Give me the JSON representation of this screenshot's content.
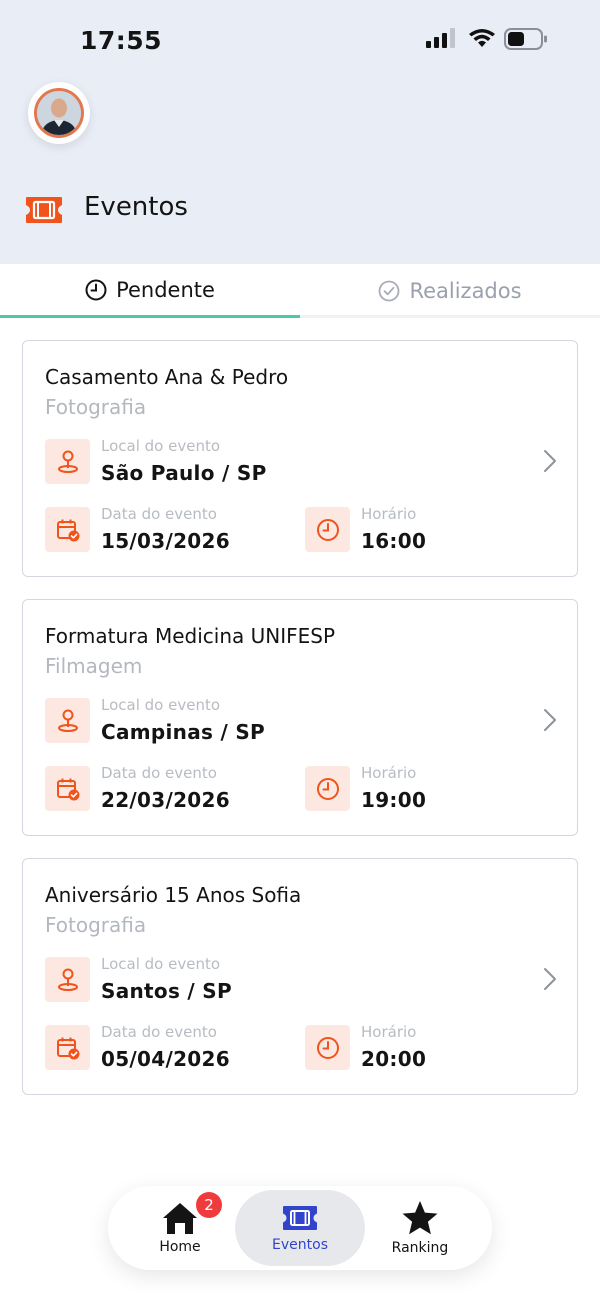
{
  "status_bar": {
    "time": "17:55"
  },
  "header": {
    "title": "Eventos",
    "icon": "ticket-icon"
  },
  "tabs": [
    {
      "label": "Pendente",
      "icon": "clock-icon",
      "active": true
    },
    {
      "label": "Realizados",
      "icon": "check-circle-icon",
      "active": false
    }
  ],
  "events": [
    {
      "title": "Casamento Ana & Pedro",
      "type": "Fotografia",
      "location_label": "Local do evento",
      "location": "São Paulo / SP",
      "date_label": "Data do evento",
      "date": "15/03/2026",
      "time_label": "Horário",
      "time": "16:00"
    },
    {
      "title": "Formatura Medicina UNIFESP",
      "type": "Filmagem",
      "location_label": "Local do evento",
      "location": "Campinas / SP",
      "date_label": "Data do evento",
      "date": "22/03/2026",
      "time_label": "Horário",
      "time": "19:00"
    },
    {
      "title": "Aniversário 15 Anos Sofia",
      "type": "Fotografia",
      "location_label": "Local do evento",
      "location": "Santos / SP",
      "date_label": "Data do evento",
      "date": "05/04/2026",
      "time_label": "Horário",
      "time": "20:00"
    }
  ],
  "nav": {
    "home": {
      "label": "Home",
      "badge": "2"
    },
    "events": {
      "label": "Eventos",
      "active": true
    },
    "ranking": {
      "label": "Ranking"
    }
  },
  "colors": {
    "accent_orange": "#f0531c",
    "icon_bg": "#fde8e1",
    "tab_underline": "#48c9b0",
    "nav_active": "#3344cc",
    "header_bg": "#e9edf5",
    "badge": "#ef3b3b"
  }
}
